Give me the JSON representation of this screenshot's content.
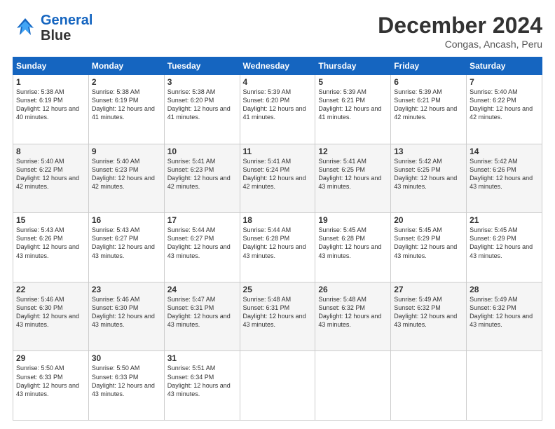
{
  "logo": {
    "line1": "General",
    "line2": "Blue"
  },
  "title": "December 2024",
  "subtitle": "Congas, Ancash, Peru",
  "days_of_week": [
    "Sunday",
    "Monday",
    "Tuesday",
    "Wednesday",
    "Thursday",
    "Friday",
    "Saturday"
  ],
  "weeks": [
    [
      {
        "day": 1,
        "sunrise": "5:38 AM",
        "sunset": "6:19 PM",
        "daylight": "12 hours and 40 minutes."
      },
      {
        "day": 2,
        "sunrise": "5:38 AM",
        "sunset": "6:19 PM",
        "daylight": "12 hours and 41 minutes."
      },
      {
        "day": 3,
        "sunrise": "5:38 AM",
        "sunset": "6:20 PM",
        "daylight": "12 hours and 41 minutes."
      },
      {
        "day": 4,
        "sunrise": "5:39 AM",
        "sunset": "6:20 PM",
        "daylight": "12 hours and 41 minutes."
      },
      {
        "day": 5,
        "sunrise": "5:39 AM",
        "sunset": "6:21 PM",
        "daylight": "12 hours and 41 minutes."
      },
      {
        "day": 6,
        "sunrise": "5:39 AM",
        "sunset": "6:21 PM",
        "daylight": "12 hours and 42 minutes."
      },
      {
        "day": 7,
        "sunrise": "5:40 AM",
        "sunset": "6:22 PM",
        "daylight": "12 hours and 42 minutes."
      }
    ],
    [
      {
        "day": 8,
        "sunrise": "5:40 AM",
        "sunset": "6:22 PM",
        "daylight": "12 hours and 42 minutes."
      },
      {
        "day": 9,
        "sunrise": "5:40 AM",
        "sunset": "6:23 PM",
        "daylight": "12 hours and 42 minutes."
      },
      {
        "day": 10,
        "sunrise": "5:41 AM",
        "sunset": "6:23 PM",
        "daylight": "12 hours and 42 minutes."
      },
      {
        "day": 11,
        "sunrise": "5:41 AM",
        "sunset": "6:24 PM",
        "daylight": "12 hours and 42 minutes."
      },
      {
        "day": 12,
        "sunrise": "5:41 AM",
        "sunset": "6:25 PM",
        "daylight": "12 hours and 43 minutes."
      },
      {
        "day": 13,
        "sunrise": "5:42 AM",
        "sunset": "6:25 PM",
        "daylight": "12 hours and 43 minutes."
      },
      {
        "day": 14,
        "sunrise": "5:42 AM",
        "sunset": "6:26 PM",
        "daylight": "12 hours and 43 minutes."
      }
    ],
    [
      {
        "day": 15,
        "sunrise": "5:43 AM",
        "sunset": "6:26 PM",
        "daylight": "12 hours and 43 minutes."
      },
      {
        "day": 16,
        "sunrise": "5:43 AM",
        "sunset": "6:27 PM",
        "daylight": "12 hours and 43 minutes."
      },
      {
        "day": 17,
        "sunrise": "5:44 AM",
        "sunset": "6:27 PM",
        "daylight": "12 hours and 43 minutes."
      },
      {
        "day": 18,
        "sunrise": "5:44 AM",
        "sunset": "6:28 PM",
        "daylight": "12 hours and 43 minutes."
      },
      {
        "day": 19,
        "sunrise": "5:45 AM",
        "sunset": "6:28 PM",
        "daylight": "12 hours and 43 minutes."
      },
      {
        "day": 20,
        "sunrise": "5:45 AM",
        "sunset": "6:29 PM",
        "daylight": "12 hours and 43 minutes."
      },
      {
        "day": 21,
        "sunrise": "5:45 AM",
        "sunset": "6:29 PM",
        "daylight": "12 hours and 43 minutes."
      }
    ],
    [
      {
        "day": 22,
        "sunrise": "5:46 AM",
        "sunset": "6:30 PM",
        "daylight": "12 hours and 43 minutes."
      },
      {
        "day": 23,
        "sunrise": "5:46 AM",
        "sunset": "6:30 PM",
        "daylight": "12 hours and 43 minutes."
      },
      {
        "day": 24,
        "sunrise": "5:47 AM",
        "sunset": "6:31 PM",
        "daylight": "12 hours and 43 minutes."
      },
      {
        "day": 25,
        "sunrise": "5:48 AM",
        "sunset": "6:31 PM",
        "daylight": "12 hours and 43 minutes."
      },
      {
        "day": 26,
        "sunrise": "5:48 AM",
        "sunset": "6:32 PM",
        "daylight": "12 hours and 43 minutes."
      },
      {
        "day": 27,
        "sunrise": "5:49 AM",
        "sunset": "6:32 PM",
        "daylight": "12 hours and 43 minutes."
      },
      {
        "day": 28,
        "sunrise": "5:49 AM",
        "sunset": "6:32 PM",
        "daylight": "12 hours and 43 minutes."
      }
    ],
    [
      {
        "day": 29,
        "sunrise": "5:50 AM",
        "sunset": "6:33 PM",
        "daylight": "12 hours and 43 minutes."
      },
      {
        "day": 30,
        "sunrise": "5:50 AM",
        "sunset": "6:33 PM",
        "daylight": "12 hours and 43 minutes."
      },
      {
        "day": 31,
        "sunrise": "5:51 AM",
        "sunset": "6:34 PM",
        "daylight": "12 hours and 43 minutes."
      },
      null,
      null,
      null,
      null
    ]
  ]
}
